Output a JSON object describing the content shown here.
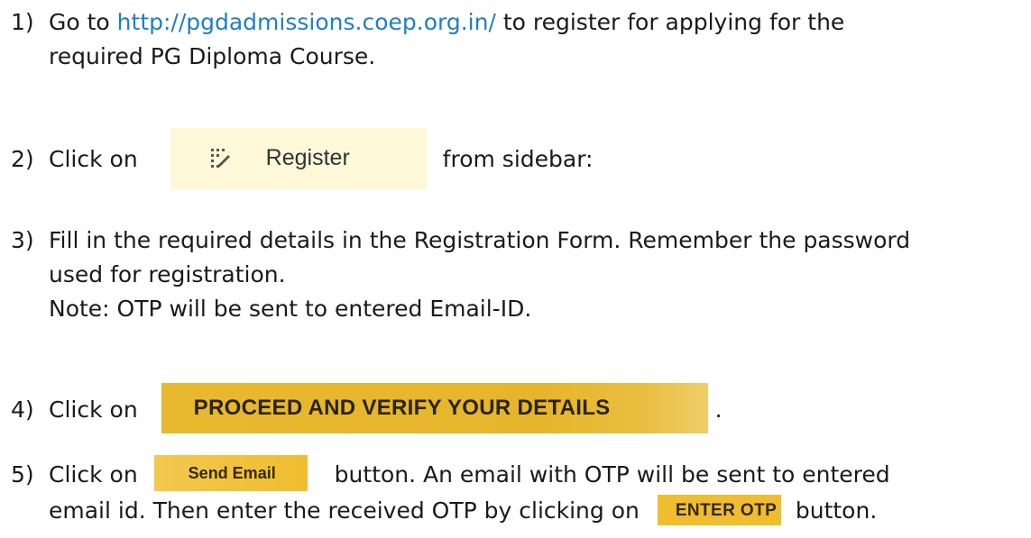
{
  "steps": {
    "s1": {
      "num": "1)",
      "pre": "Go to ",
      "link": "http://pgdadmissions.coep.org.in/",
      "post": " to register for applying for the",
      "line2": "required PG Diploma Course."
    },
    "s2": {
      "num": "2)",
      "pre": "Click  on",
      "button_icon": "register-grid-pencil-icon",
      "button_label": "Register",
      "post": "from sidebar:"
    },
    "s3": {
      "num": "3)",
      "line1": "Fill in the required details in the Registration Form. Remember the password",
      "line2": "used for registration.",
      "line3": "Note: OTP will be sent to entered Email-ID."
    },
    "s4": {
      "num": "4)",
      "pre": "Click on",
      "button_label": "PROCEED AND VERIFY YOUR DETAILS",
      "post": "."
    },
    "s5": {
      "num": "5)",
      "pre": "Click on",
      "send_label": "Send Email",
      "post1": "button. An email with OTP will be sent to entered",
      "line2_pre": "email id. Then enter the received OTP by clicking on",
      "otp_label": "ENTER OTP",
      "line2_post": "button."
    }
  },
  "colors": {
    "link": "#1f7fc4",
    "register_bg": "#fdf9d8",
    "button_yellow": "#efbd2f"
  }
}
